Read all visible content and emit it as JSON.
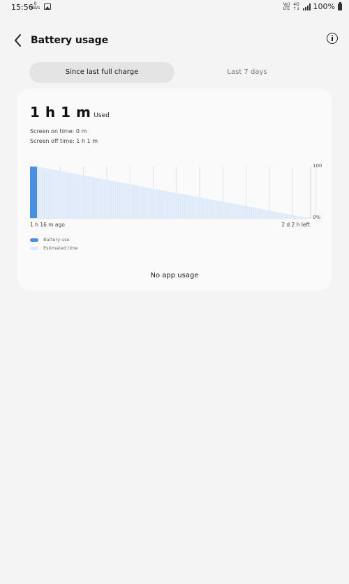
{
  "status_bar": {
    "time": "15:56",
    "data_speed": "0",
    "data_unit": "KB/s",
    "net_top": "Vo)",
    "net_bottom": "LTE",
    "net2_top": "4G",
    "net2_bottom": "↑↓",
    "battery_percent": "100%"
  },
  "header": {
    "title": "Battery usage"
  },
  "tabs": [
    {
      "label": "Since last full charge",
      "active": true
    },
    {
      "label": "Last 7 days",
      "active": false
    }
  ],
  "summary": {
    "used_value": "1 h 1 m",
    "used_label": "Used",
    "screen_on": "Screen on time: 0 m",
    "screen_off": "Screen off time: 1 h 1 m"
  },
  "chart_data": {
    "type": "area",
    "x_start_label": "1 h 16 m ago",
    "x_end_label": "2 d 2 h left",
    "y_ticks": [
      "100",
      "0%"
    ],
    "ylim": [
      0,
      100
    ],
    "series": [
      {
        "name": "Battery use",
        "color": "#4a90e2",
        "points": [
          [
            0,
            100
          ],
          [
            1,
            100
          ]
        ]
      },
      {
        "name": "Estimated time",
        "color": "#dce9f8",
        "points": [
          [
            1,
            100
          ],
          [
            40,
            0
          ]
        ]
      }
    ]
  },
  "legend": [
    {
      "label": "Battery use",
      "color": "#4a90e2"
    },
    {
      "label": "Estimated time",
      "color": "#dce9f8"
    }
  ],
  "empty_state": "No app usage",
  "colors": {
    "accent": "#4a90e2",
    "estimate": "#dce9f8",
    "background": "#f4f4f4",
    "card": "#fafafa"
  }
}
